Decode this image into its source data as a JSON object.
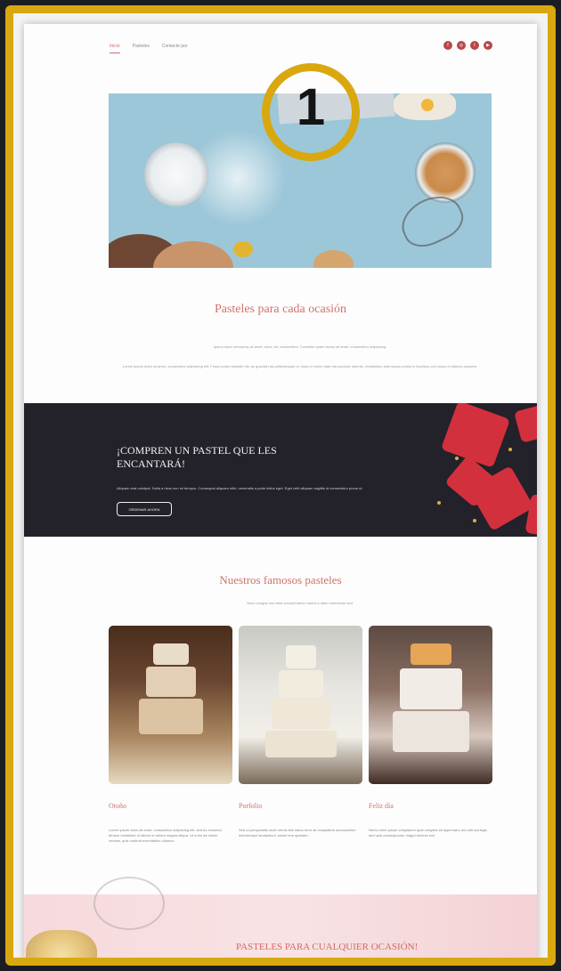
{
  "nav": {
    "links": [
      "Inicio",
      "Pasteles",
      "Contacte por"
    ],
    "socials": [
      "facebook-icon",
      "instagram-icon",
      "twitter-icon",
      "youtube-icon"
    ]
  },
  "intro": {
    "title": "Pasteles para cada ocasión",
    "lead": "Ipsum dolor nonummy sit amet, dolor vel, consectetur. Curabitur quam lectus sit amet, consectetur adipiscing.",
    "paragraph": "Lorem ipsum dolor sit amet, consectetur adipiscing elit. Fusce porta molestie elit, ac gravida nisl pellentesque ut. Nunc in tortor vitae nisi pulvinar lobortis. Vestibulum ante ipsum primis in faucibus orci luctus et ultrices posuere."
  },
  "banner": {
    "title": "¡COMPREN UN PASTEL QUE LES ENCANTARÁ!",
    "text": "Aliquam erat volutpat. Nulla a risus non mi tempus. Consequat aliquam nibh, venenatis a pede tellus eget. Eget velit aliquam sagittis id consectetur purus ut.",
    "button": "ORDENAR AHORA"
  },
  "cakes": {
    "title": "Nuestros famosos pasteles",
    "lead": "Nunc congue nisi vitae suscipit tellus mauris a diam maecenas sed.",
    "items": [
      {
        "name": "Otoño",
        "text": "Lorem ipsum dolor sit amet, consectetur adipiscing elit, sed do eiusmod tempor incididunt ut labore et dolore magna aliqua. Ut enim ad minim veniam, quis nostrud exercitation ullamco."
      },
      {
        "name": "Porfolio",
        "text": "Sed ut perspiciatis unde omnis iste natus error sit voluptatem accusantium doloremque laudantium, totam rem aperiam."
      },
      {
        "name": "Feliz día",
        "text": "Nemo enim ipsam voluptatem quia voluptas sit aspernatur aut odit aut fugit, sed quia consequuntur magni dolores eos."
      }
    ]
  },
  "footer_band": {
    "title": "PASTELES PARA CUALQUIER OCASIÓN!"
  },
  "callout": {
    "number": "1"
  }
}
